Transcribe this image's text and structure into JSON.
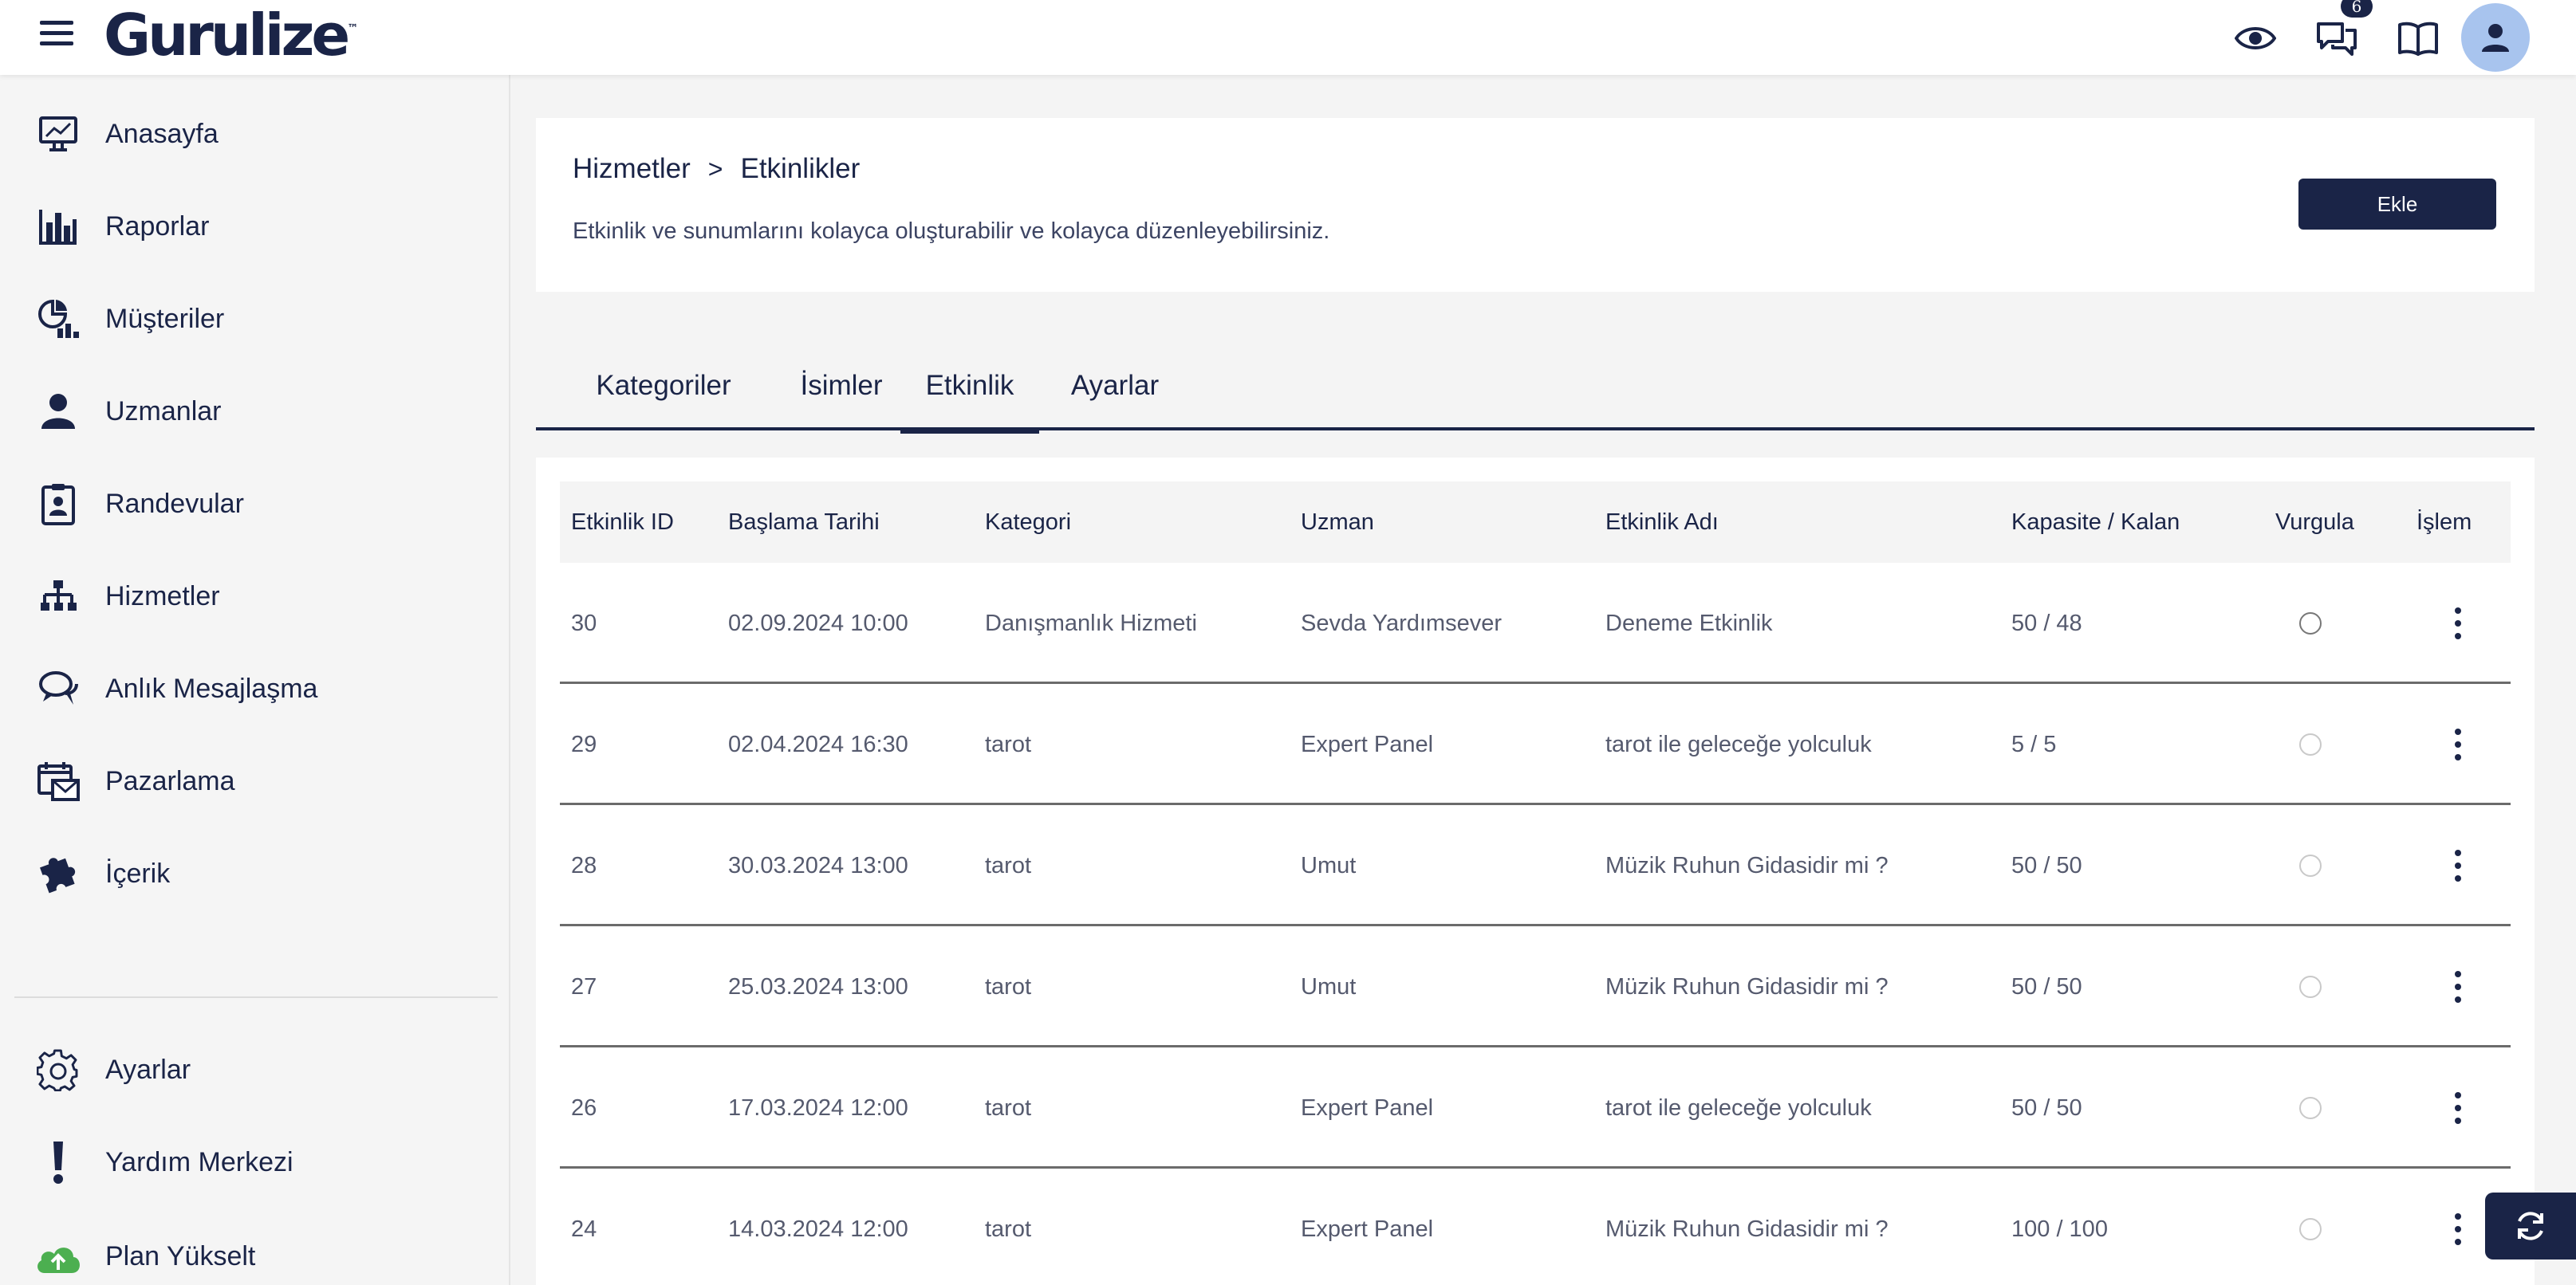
{
  "app": {
    "brand": "Gurulize",
    "trademark": "™",
    "brand_color": "#1a2447",
    "notification_count": "6"
  },
  "header_icons": [
    "eye-icon",
    "chat-icon",
    "book-icon",
    "user-icon"
  ],
  "sidebar": {
    "items": [
      {
        "label": "Anasayfa",
        "icon": "monitor-chart-icon"
      },
      {
        "label": "Raporlar",
        "icon": "bar-chart-icon"
      },
      {
        "label": "Müşteriler",
        "icon": "pie-chart-icon"
      },
      {
        "label": "Uzmanlar",
        "icon": "user-icon"
      },
      {
        "label": "Randevular",
        "icon": "clipboard-user-icon"
      },
      {
        "label": "Hizmetler",
        "icon": "sitemap-icon"
      },
      {
        "label": "Anlık Mesajlaşma",
        "icon": "chat-bubbles-icon"
      },
      {
        "label": "Pazarlama",
        "icon": "calendar-mail-icon"
      },
      {
        "label": "İçerik",
        "icon": "puzzle-icon"
      }
    ],
    "bottom_items": [
      {
        "label": "Ayarlar",
        "icon": "gear-icon"
      },
      {
        "label": "Yardım Merkezi",
        "icon": "exclamation-icon"
      },
      {
        "label": "Plan Yükselt",
        "icon": "upload-cloud-icon"
      }
    ]
  },
  "page": {
    "breadcrumb": [
      "Hizmetler",
      "Etkinlikler"
    ],
    "breadcrumb_separator": ">",
    "subtitle": "Etkinlik ve sunumlarını kolayca oluşturabilir ve kolayca düzenleyebilirsiniz.",
    "add_button": "Ekle"
  },
  "tabs": [
    {
      "label": "Kategoriler",
      "active": false
    },
    {
      "label": "İsimler",
      "active": false
    },
    {
      "label": "Etkinlik",
      "active": true
    },
    {
      "label": "Ayarlar",
      "active": false
    }
  ],
  "table": {
    "columns": [
      "Etkinlik ID",
      "Başlama Tarihi",
      "Kategori",
      "Uzman",
      "Etkinlik Adı",
      "Kapasite / Kalan",
      "Vurgula",
      "İşlem"
    ],
    "rows": [
      {
        "id": "30",
        "date": "02.09.2024 10:00",
        "category": "Danışmanlık Hizmeti",
        "expert": "Sevda Yardımsever",
        "name": "Deneme Etkinlik",
        "capacity": "50 / 48",
        "highlight": false
      },
      {
        "id": "29",
        "date": "02.04.2024 16:30",
        "category": "tarot",
        "expert": "Expert Panel",
        "name": "tarot ile geleceğe yolculuk",
        "capacity": "5 / 5",
        "highlight": false
      },
      {
        "id": "28",
        "date": "30.03.2024 13:00",
        "category": "tarot",
        "expert": "Umut",
        "name": "Müzik Ruhun Gidasidir mi ?",
        "capacity": "50 / 50",
        "highlight": false
      },
      {
        "id": "27",
        "date": "25.03.2024 13:00",
        "category": "tarot",
        "expert": "Umut",
        "name": "Müzik Ruhun Gidasidir mi ?",
        "capacity": "50 / 50",
        "highlight": false
      },
      {
        "id": "26",
        "date": "17.03.2024 12:00",
        "category": "tarot",
        "expert": "Expert Panel",
        "name": "tarot ile geleceğe yolculuk",
        "capacity": "50 / 50",
        "highlight": false
      },
      {
        "id": "24",
        "date": "14.03.2024 12:00",
        "category": "tarot",
        "expert": "Expert Panel",
        "name": "Müzik Ruhun Gidasidir mi ?",
        "capacity": "100 / 100",
        "highlight": false
      }
    ]
  }
}
